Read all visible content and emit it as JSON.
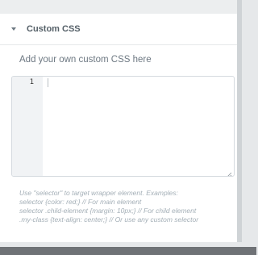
{
  "section": {
    "title": "Custom CSS",
    "collapse_icon": "caret-down-icon"
  },
  "description": "Add your own custom CSS here",
  "editor": {
    "line_numbers": [
      "1"
    ],
    "content": "",
    "resize_icon": "resize-handle-icon"
  },
  "hint_lines": [
    "Use \"selector\" to target wrapper element. Examples:",
    "selector {color: red;} // For main element",
    "selector .child-element {margin: 10px;} // For child element",
    ".my-class {text-align: center;} // Or use any custom selector"
  ],
  "colors": {
    "panel_bg": "#ffffff",
    "title_text": "#556068",
    "hint_text": "#a4afb7"
  }
}
